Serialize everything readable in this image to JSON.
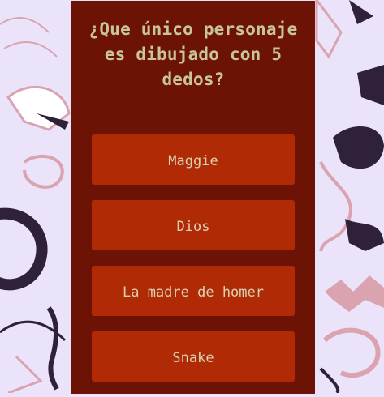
{
  "quiz": {
    "question": "¿Que único personaje es dibujado con 5 dedos?",
    "answers": [
      "Maggie",
      "Dios",
      "La madre de homer",
      "Snake"
    ]
  },
  "colors": {
    "page_background": "#ebe3fa",
    "panel_background": "#6c1305",
    "answer_background": "#b02a05",
    "question_text": "#c8c49b",
    "answer_text": "#d9d2b2",
    "doodle_dark": "#2f2137",
    "doodle_pink": "#d9a3b0"
  }
}
